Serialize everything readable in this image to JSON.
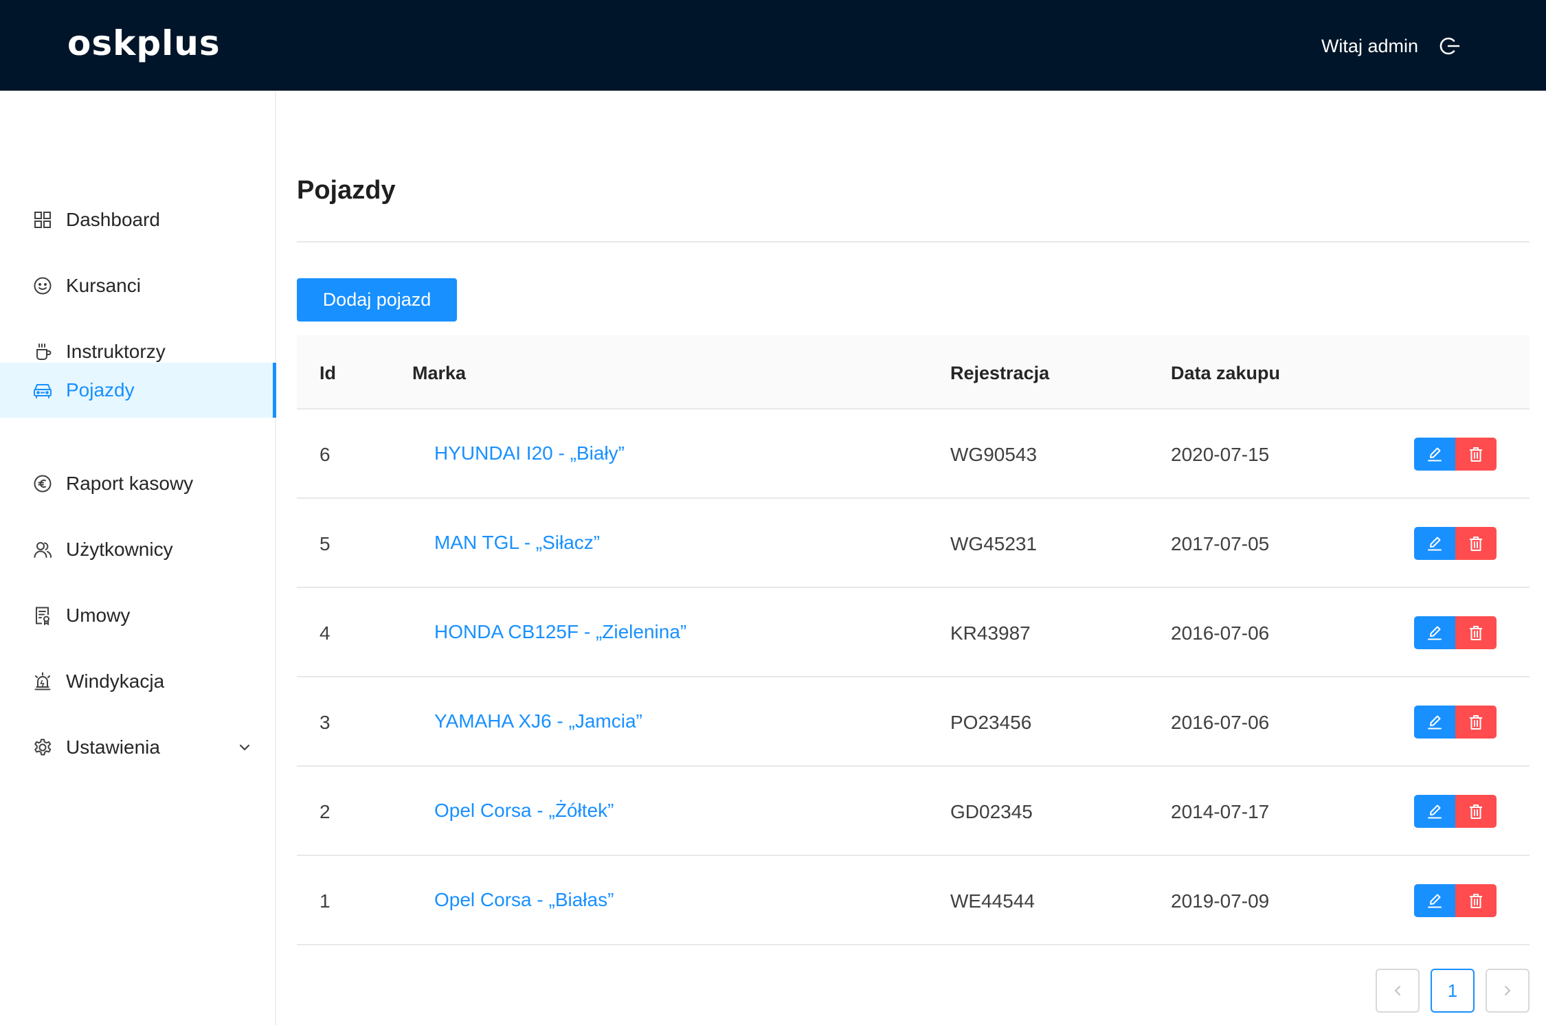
{
  "header": {
    "logo": "oskplus",
    "welcome": "Witaj admin",
    "logout_icon": "logout-icon"
  },
  "sidebar": {
    "items": [
      {
        "label": "Dashboard",
        "icon": "dashboard-icon"
      },
      {
        "label": "Kursanci",
        "icon": "smile-icon"
      },
      {
        "label": "Instruktorzy",
        "icon": "coffee-icon"
      },
      {
        "label": "Pojazdy",
        "icon": "car-icon",
        "active": true
      },
      {
        "label": "Raport kasowy",
        "icon": "euro-icon"
      },
      {
        "label": "Użytkownicy",
        "icon": "team-icon"
      },
      {
        "label": "Umowy",
        "icon": "file-icon"
      },
      {
        "label": "Windykacja",
        "icon": "alert-icon"
      },
      {
        "label": "Ustawienia",
        "icon": "setting-icon",
        "expandable": true
      }
    ]
  },
  "main": {
    "title": "Pojazdy",
    "add_button": "Dodaj pojazd",
    "table": {
      "columns": [
        "Id",
        "Marka",
        "Rejestracja",
        "Data zakupu"
      ],
      "rows": [
        {
          "id": "6",
          "marka": "HYUNDAI I20 - „Biały”",
          "rejestracja": "WG90543",
          "data": "2020-07-15"
        },
        {
          "id": "5",
          "marka": "MAN TGL - „Siłacz”",
          "rejestracja": "WG45231",
          "data": "2017-07-05"
        },
        {
          "id": "4",
          "marka": "HONDA CB125F - „Zielenina”",
          "rejestracja": "KR43987",
          "data": "2016-07-06"
        },
        {
          "id": "3",
          "marka": "YAMAHA XJ6 - „Jamcia”",
          "rejestracja": "PO23456",
          "data": "2016-07-06"
        },
        {
          "id": "2",
          "marka": "Opel Corsa - „Żółtek”",
          "rejestracja": "GD02345",
          "data": "2014-07-17"
        },
        {
          "id": "1",
          "marka": "Opel Corsa - „Białas”",
          "rejestracja": "WE44544",
          "data": "2019-07-09"
        }
      ]
    },
    "pagination": {
      "current": "1"
    }
  },
  "colors": {
    "header_bg": "#001529",
    "primary": "#1890ff",
    "danger": "#ff4d4f",
    "active_bg": "#e6f7ff"
  }
}
